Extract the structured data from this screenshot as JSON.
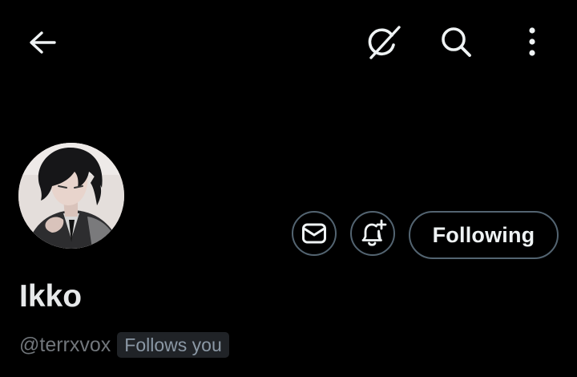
{
  "header": {
    "back_icon": "arrow-left-icon",
    "grok_icon": "grok-icon",
    "search_icon": "search-icon",
    "more_icon": "more-vertical-icon"
  },
  "profile": {
    "display_name": "Ikko",
    "handle": "@terrxvox",
    "follows_you_badge": "Follows you",
    "avatar_icon": "avatar"
  },
  "actions": {
    "message_icon": "mail-icon",
    "notification_icon": "bell-plus-icon",
    "following_label": "Following"
  },
  "colors": {
    "background": "#000000",
    "text_primary": "#e7e9ea",
    "text_secondary": "#71767b",
    "border": "#536471",
    "badge_bg": "#202327"
  }
}
